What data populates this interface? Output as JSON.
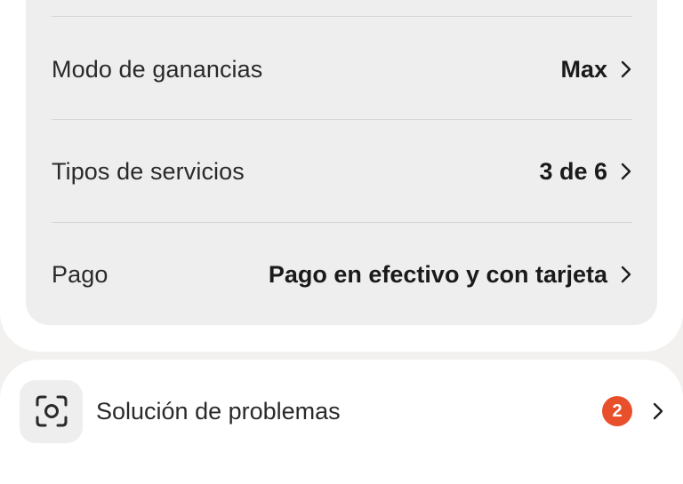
{
  "settings": {
    "rows": [
      {
        "label": "Modo de ganancias",
        "value": "Max"
      },
      {
        "label": "Tipos de servicios",
        "value": "3 de 6"
      },
      {
        "label": "Pago",
        "value": "Pago en efectivo y con tarjeta"
      }
    ]
  },
  "troubleshooting": {
    "label": "Solución de problemas",
    "badge_count": "2",
    "icon": "focus-scan-icon"
  },
  "colors": {
    "badge": "#e8502c",
    "panel": "#eeeeee",
    "page_background": "#f3f1ef"
  }
}
